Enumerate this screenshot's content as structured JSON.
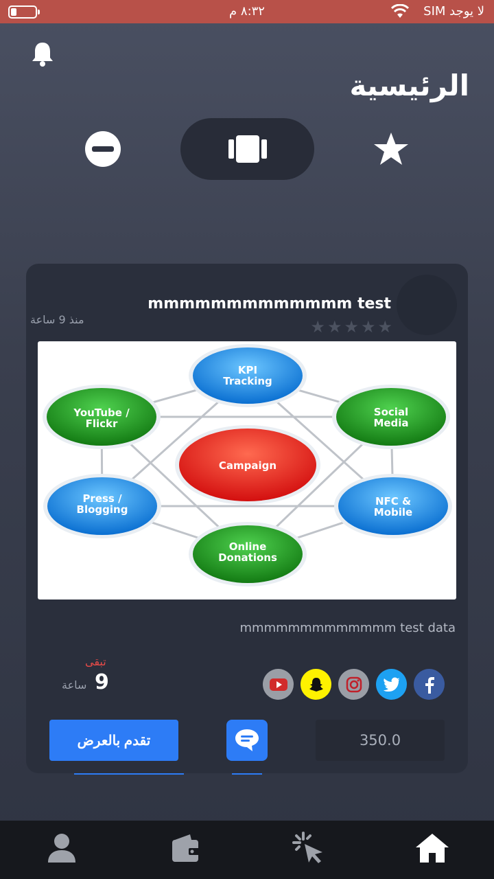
{
  "status_bar": {
    "carrier": "لا يوجد SIM",
    "time": "٨:٣٢ م"
  },
  "header": {
    "title": "الرئيسية"
  },
  "filters": [
    "remove",
    "cards",
    "favorites"
  ],
  "card": {
    "title": "mmmmmmmmmmmmm test",
    "time_ago": "منذ 9 ساعة",
    "rating": 0,
    "image_nodes": [
      "KPI Tracking",
      "Social Media",
      "NFC & Mobile",
      "Online Donations",
      "Press / Blogging",
      "YouTube / Flickr",
      "Campaign"
    ],
    "description": "mmmmmmmmmmmmm test data",
    "remaining_label": "تبقى",
    "remaining_value": "9",
    "remaining_unit": "ساعة",
    "socials": [
      "youtube-icon",
      "snapchat-icon",
      "instagram-icon",
      "twitter-icon",
      "facebook-icon"
    ],
    "bid_button": "تقدم بالعرض",
    "price": "350.0"
  },
  "nav": [
    "profile",
    "wallet",
    "click",
    "home"
  ],
  "colors": {
    "accent": "#2d7cf6",
    "status_bar": "#b85149",
    "remaining": "#e94b48"
  }
}
